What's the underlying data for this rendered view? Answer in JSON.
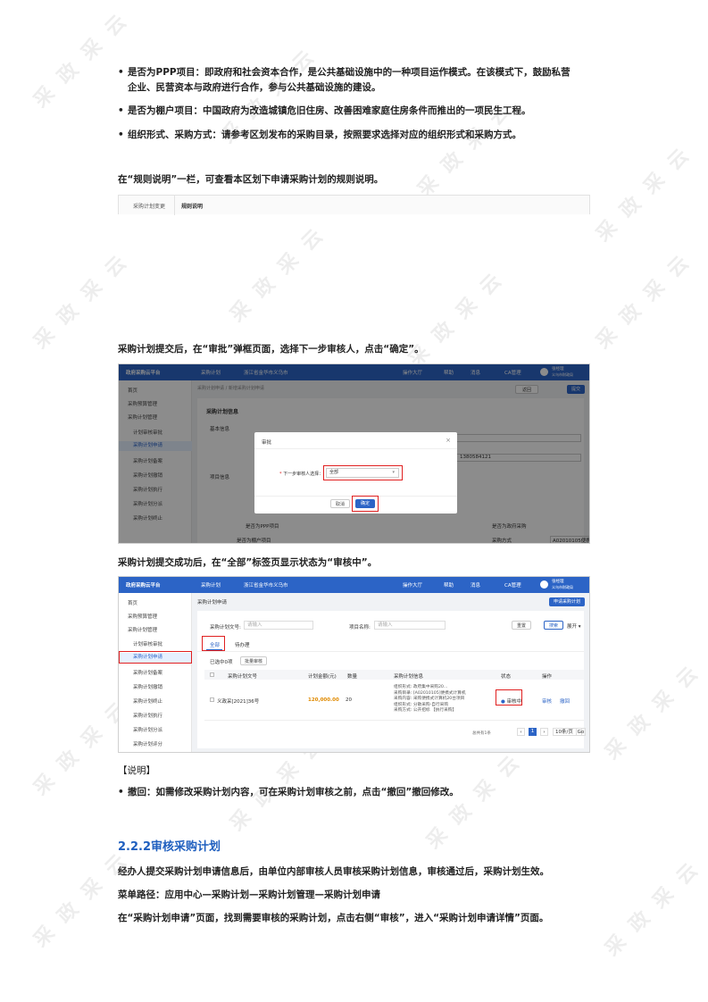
{
  "watermark": "采 政 采 云",
  "bullets": [
    {
      "line1": "是否为PPP项目：即政府和社会资本合作，是公共基础设施中的一种项目运作模式。在该模式下，鼓励私营",
      "line2": "企业、民营资本与政府进行合作，参与公共基础设施的建设。"
    },
    {
      "line1": "是否为棚户项目：中国政府为改造城镇危旧住房、改善困难家庭住房条件而推出的一项民生工程。",
      "line2": ""
    },
    {
      "line1": "组织形式、采购方式：请参考区划发布的采购目录，按照要求选择对应的组织形式和采购方式。",
      "line2": ""
    }
  ],
  "para_rules": "在“规则说明”一栏，可查看本区划下申请采购计划的规则说明。",
  "rule_strip": {
    "left": "采购计划变更",
    "right": "规则说明"
  },
  "para_submit": "采购计划提交后，在“审批”弹框页面，选择下一步审核人，点击“确定”。",
  "shot1": {
    "logo": "政府采购云平台",
    "nav_plan": "采购计划",
    "nav_org": "浙江省金华市义乌市",
    "nav_hall": "操作大厅",
    "nav_help": "帮助",
    "nav_msg": "消息",
    "nav_ca": "CA管理",
    "user_name": "张经理",
    "user_org": "义乌市财政局",
    "breadcrumb": "采购计划申请 / 新增采购计划申请",
    "btn_back": "返回",
    "btn_submit": "提交",
    "sidebar": [
      "首页",
      "采购预算管理",
      "采购计划管理",
      "计划审核审批",
      "采购计划申请",
      "采购计划备案",
      "采购计划撤销",
      "采购计划执行",
      "采购计划分派",
      "采购计划终止"
    ],
    "section_title": "采购计划信息",
    "section_basic": "基本信息",
    "section_project": "项目信息",
    "field_code": "1380584121",
    "field_ppp": "是否为PPP项目",
    "field_shanty": "是否为棚户项目",
    "field_type": "是否为政府采购",
    "field_method": "采购方式",
    "field_method_val": "A02010105便携式计算机",
    "field_yes": "是",
    "field_no": "否",
    "modal_title": "审批",
    "modal_label": "下一步审核人选择：",
    "modal_select": "全部",
    "modal_cancel": "取消",
    "modal_ok": "确定"
  },
  "para_success": "采购计划提交成功后，在“全部”标签页显示状态为“审核中”。",
  "shot2": {
    "logo": "政府采购云平台",
    "nav_plan": "采购计划",
    "nav_org": "浙江省金华市义乌市",
    "nav_hall": "操作大厅",
    "nav_help": "帮助",
    "nav_msg": "消息",
    "nav_ca": "CA管理",
    "user_name": "张经理",
    "user_org": "义乌市财政局",
    "page_title": "采购计划申请",
    "btn_apply": "申请采购计划",
    "sidebar": [
      "首页",
      "采购预算管理",
      "采购计划管理",
      "计划审核审批",
      "采购计划申请",
      "采购计划备案",
      "采购计划撤销",
      "采购计划终止",
      "采购计划执行",
      "采购计划分派",
      "采购计划评分"
    ],
    "search_code_label": "采购计划文号:",
    "search_code_ph": "请输入",
    "search_name_label": "项目名称:",
    "search_name_ph": "请输入",
    "btn_reset": "重置",
    "btn_search": "搜索",
    "btn_expand": "展开",
    "tab_all": "全部",
    "tab_todo": "待办理",
    "selected_text": "已选中0项",
    "btn_batch": "批量审核",
    "col_code": "采购计划文号",
    "col_amount": "计划金额(元)",
    "col_qty": "数量",
    "col_info": "采购计划信息",
    "col_status": "状态",
    "col_op": "操作",
    "row": {
      "code": "义政采[2021]36号",
      "amount": "120,000.00",
      "qty": "20",
      "info": [
        "组织形式: 政府集中采购20...",
        "采购目录: [A02010105]便携式计算机",
        "采购内容: 采购便携式计算机20台项目",
        "组织形式: 分散采购-自行采购",
        "采购方式: 公开招标 【执行采购】"
      ],
      "status": "审核中",
      "op_review": "审核",
      "op_withdraw": "撤回"
    },
    "pager_total": "总共有1条",
    "pager_page": "1",
    "pager_size": "10条/页",
    "pager_go": "Go"
  },
  "note_title": "【说明】",
  "note_bullet": "撤回：如需修改采购计划内容，可在采购计划审核之前，点击“撤回”撤回修改。",
  "heading": "2.2.2审核采购计划",
  "para_audit": "经办人提交采购计划申请信息后，由单位内部审核人员审核采购计划信息，审核通过后，采购计划生效。",
  "menu_path": "菜单路径：应用中心—采购计划—采购计划管理—采购计划申请",
  "para_find": "在“采购计划申请”页面，找到需要审核的采购计划，点击右侧“审核”，进入“采购计划申请详情”页面。"
}
